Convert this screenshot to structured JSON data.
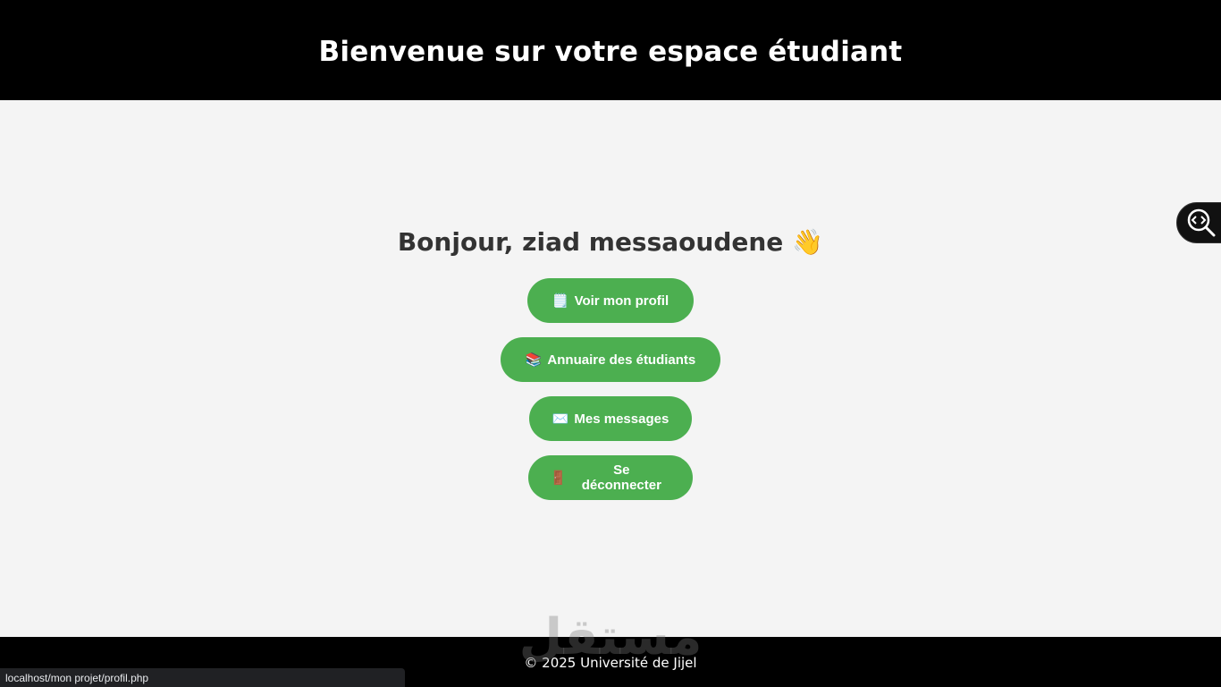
{
  "header": {
    "title": "Bienvenue sur votre espace étudiant"
  },
  "main": {
    "greeting": "Bonjour, ziad messaoudene",
    "greeting_emoji": "👋",
    "buttons": [
      {
        "icon": "🗒️",
        "icon_name": "scroll-icon",
        "label": "Voir mon profil"
      },
      {
        "icon": "📚",
        "icon_name": "books-icon",
        "label": "Annuaire des étudiants"
      },
      {
        "icon": "✉️",
        "icon_name": "envelope-icon",
        "label": "Mes messages"
      },
      {
        "icon": "🚪",
        "icon_name": "door-icon",
        "label": "Se déconnecter"
      }
    ]
  },
  "footer": {
    "text": "© 2025 Université de Jijel"
  },
  "watermark": {
    "text": "مستقل"
  },
  "status_bar": {
    "url": "localhost/mon projet/profil.php"
  },
  "side_tool": {
    "icon_name": "code-search-icon"
  },
  "colors": {
    "accent": "#4caf50",
    "header_bg": "#000000",
    "page_bg": "#f4f4f4"
  }
}
